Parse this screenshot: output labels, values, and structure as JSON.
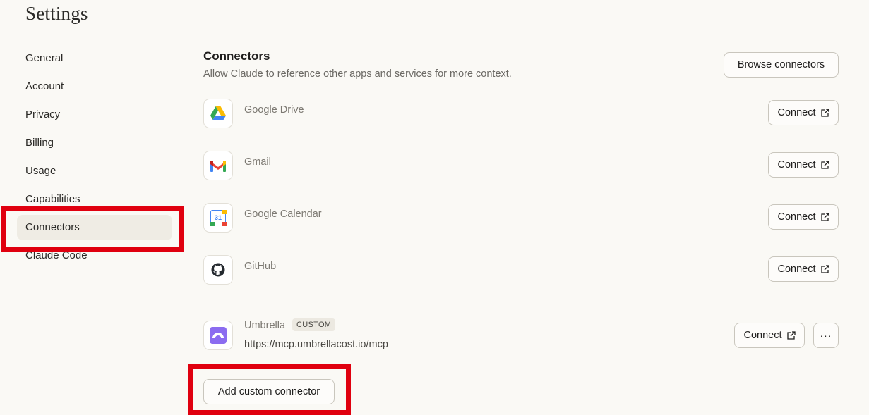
{
  "page": {
    "title": "Settings"
  },
  "sidebar": {
    "items": [
      {
        "label": "General"
      },
      {
        "label": "Account"
      },
      {
        "label": "Privacy"
      },
      {
        "label": "Billing"
      },
      {
        "label": "Usage"
      },
      {
        "label": "Capabilities"
      },
      {
        "label": "Connectors",
        "active": true
      },
      {
        "label": "Claude Code"
      }
    ]
  },
  "connectors": {
    "title": "Connectors",
    "description": "Allow Claude to reference other apps and services for more context.",
    "browse_label": "Browse connectors",
    "connect_label": "Connect",
    "items": [
      {
        "name": "Google Drive",
        "icon": "google-drive-icon"
      },
      {
        "name": "Gmail",
        "icon": "gmail-icon"
      },
      {
        "name": "Google Calendar",
        "icon": "google-calendar-icon",
        "icon_text": "31"
      },
      {
        "name": "GitHub",
        "icon": "github-icon"
      }
    ],
    "custom": {
      "name": "Umbrella",
      "badge": "CUSTOM",
      "url": "https://mcp.umbrellacost.io/mcp",
      "icon": "umbrella-icon",
      "more_label": "···"
    },
    "add_custom_label": "Add custom connector"
  },
  "colors": {
    "background": "#faf9f5",
    "annotation_red": "#e0000f",
    "active_nav": "#efece4"
  }
}
